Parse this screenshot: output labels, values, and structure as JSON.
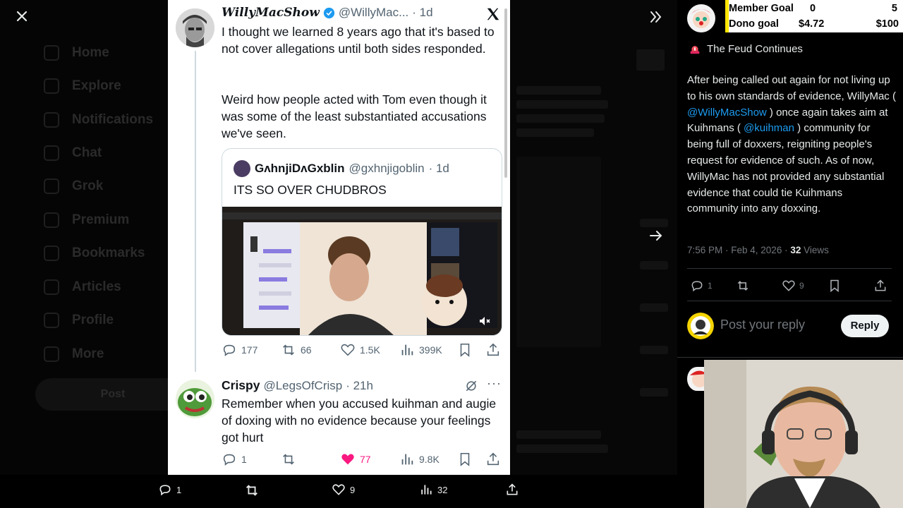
{
  "main_tweet": {
    "display_name": "WillyMacShow",
    "handle": "@WillyMac...",
    "time": "· 1d",
    "text_p1": "I thought we learned 8 years ago that it's based to not cover allegations until both sides responded.",
    "text_p2": "Weird how people acted with Tom even though it was some of the least substantiated accusations we've seen.",
    "quote": {
      "display_name": "GʌhnjiDʌGxblin",
      "handle": "@gxhnjigoblin",
      "time": "· 1d",
      "text": "ITS SO OVER CHUDBROS"
    },
    "stats": {
      "replies": "177",
      "reposts": "66",
      "likes": "1.5K",
      "views": "399K"
    }
  },
  "reply_tweet": {
    "display_name": "Crispy",
    "handle": "@LegsOfCrisp",
    "time": "· 21h",
    "text": "Remember when you accused kuihman and augie of doxing with no evidence because your feelings got hurt",
    "stats": {
      "replies": "1",
      "reposts": "",
      "likes": "77",
      "views": "9.8K"
    }
  },
  "bottom_bar": {
    "replies": "1",
    "likes": "9",
    "views": "32"
  },
  "stream_overlay": {
    "member_goal_label": "Member Goal",
    "member_goal_current": "0",
    "member_goal_target": "5",
    "dono_goal_label": "Dono goal",
    "dono_goal_current": "$4.72",
    "dono_goal_target": "$100"
  },
  "right_tweet": {
    "heading": "The Feud Continues",
    "text_a": "After being called out again for not living up to his own standards of evidence, WillyMac (",
    "mention1": "@WillyMacShow",
    "text_b": ") once again takes aim at Kuihmans (",
    "mention2": "@kuihman",
    "text_c": ") community for being full of doxxers, reigniting people's request for evidence of such. As of now, WillyMac has not provided any substantial evidence that could tie Kuihmans community into any doxxing.",
    "meta_time": "7:56 PM · Feb 4, 2026 · ",
    "meta_views_count": "32",
    "meta_views_label": " Views",
    "stats": {
      "replies": "1",
      "likes": "9"
    },
    "reply_placeholder": "Post your reply",
    "reply_button": "Reply"
  },
  "background_nav": {
    "items": [
      "Home",
      "Explore",
      "Notifications",
      "Chat",
      "Grok",
      "Premium",
      "Bookmarks",
      "Articles",
      "Profile",
      "More"
    ],
    "post_button": "Post"
  },
  "colors": {
    "like_pink": "#f91880",
    "link_blue": "#1d9bf0",
    "verified_blue": "#1d9bf0",
    "goal_yellow": "#ffe600"
  }
}
